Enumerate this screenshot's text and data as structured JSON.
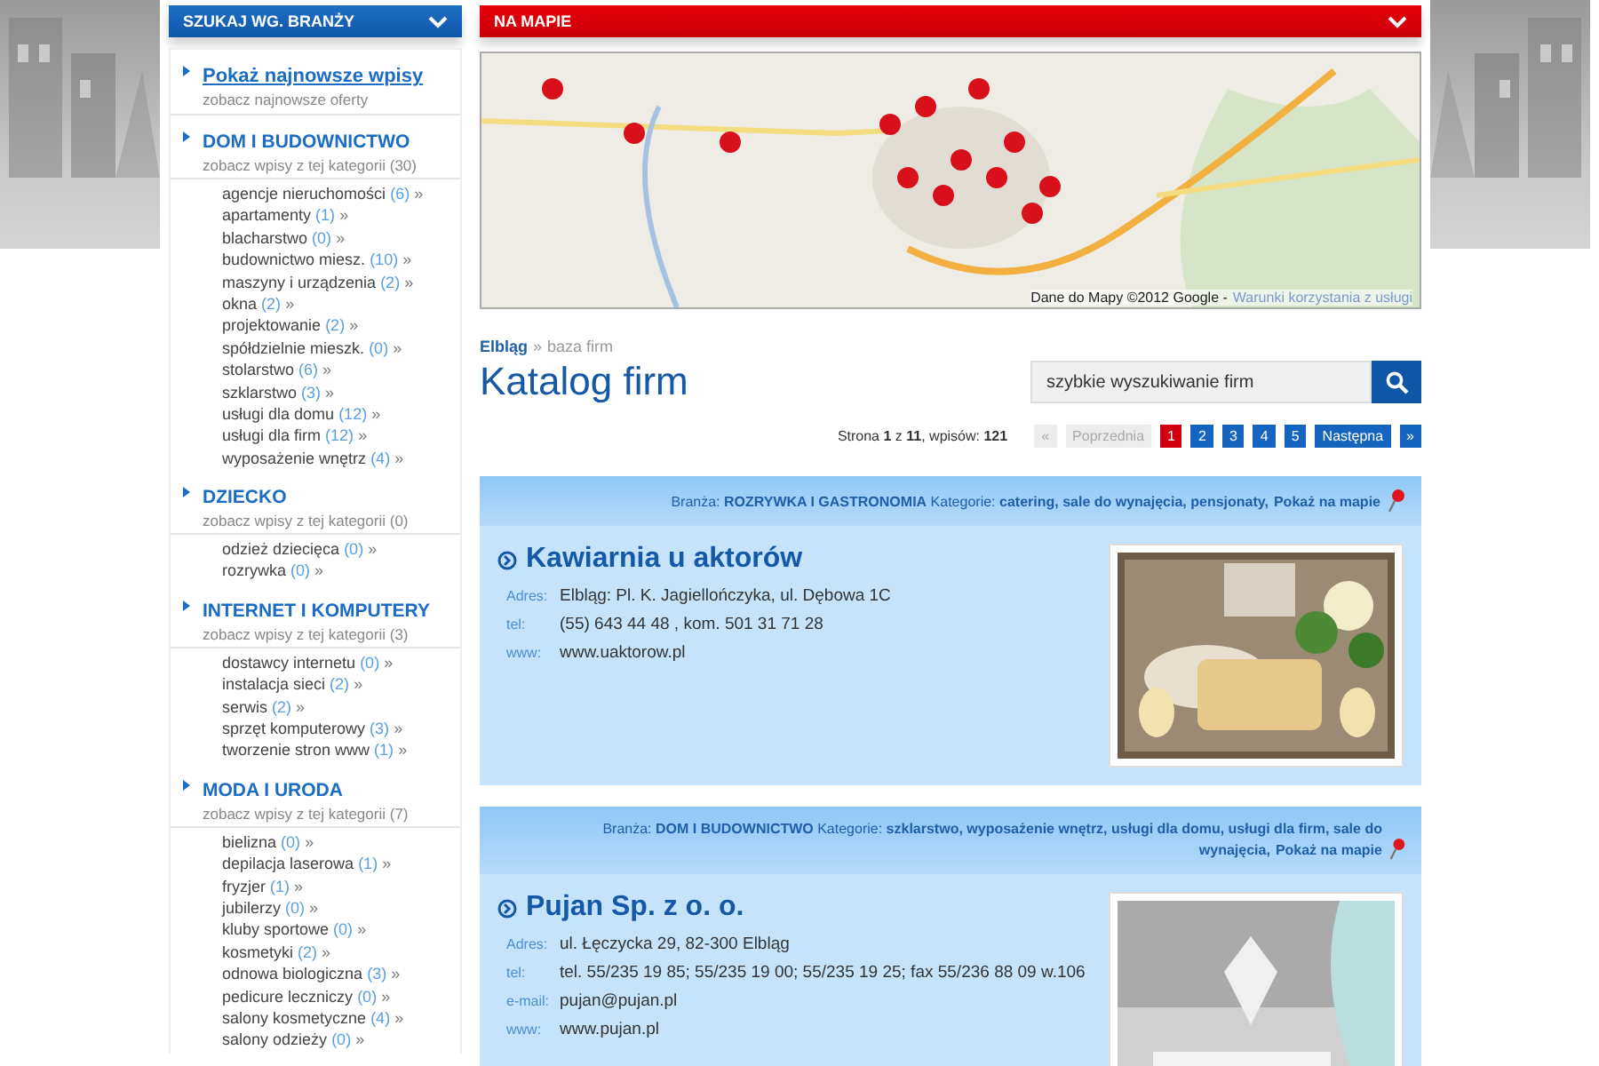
{
  "sidebar": {
    "title": "SZUKAJ WG. BRANŻY",
    "sections": [
      {
        "kind": "link",
        "title": "Pokaż najnowsze wpisy",
        "subtitle": "zobacz najnowsze oferty"
      },
      {
        "kind": "category",
        "title": "DOM I BUDOWNICTWO",
        "subtitle": "zobacz wpisy z tej kategorii",
        "count": "(30)",
        "items": [
          {
            "label": "agencje nieruchomości",
            "count": "(6)",
            "arrow": "»"
          },
          {
            "label": "apartamenty",
            "count": "(1)",
            "arrow": "»"
          },
          {
            "label": "blacharstwo",
            "count": "(0)",
            "arrow": "»"
          },
          {
            "label": "budownictwo miesz.",
            "count": "(10)",
            "arrow": "»"
          },
          {
            "label": "maszyny i urządzenia",
            "count": "(2)",
            "arrow": "»"
          },
          {
            "label": "okna",
            "count": "(2)",
            "arrow": "»"
          },
          {
            "label": "projektowanie",
            "count": "(2)",
            "arrow": "»"
          },
          {
            "label": "spółdzielnie mieszk.",
            "count": "(0)",
            "arrow": "»"
          },
          {
            "label": "stolarstwo",
            "count": "(6)",
            "arrow": "»"
          },
          {
            "label": "szklarstwo",
            "count": "(3)",
            "arrow": "»"
          },
          {
            "label": "usługi dla domu",
            "count": "(12)",
            "arrow": "»"
          },
          {
            "label": "usługi dla firm",
            "count": "(12)",
            "arrow": "»"
          },
          {
            "label": "wyposażenie wnętrz",
            "count": "(4)",
            "arrow": "»"
          }
        ]
      },
      {
        "kind": "category",
        "title": "DZIECKO",
        "subtitle": "zobacz wpisy z tej kategorii",
        "count": "(0)",
        "items": [
          {
            "label": "odzież dziecięca",
            "count": "(0)",
            "arrow": "»"
          },
          {
            "label": "rozrywka",
            "count": "(0)",
            "arrow": "»"
          }
        ]
      },
      {
        "kind": "category",
        "title": "INTERNET I KOMPUTERY",
        "subtitle": "zobacz wpisy z tej kategorii",
        "count": "(3)",
        "items": [
          {
            "label": "dostawcy internetu",
            "count": "(0)",
            "arrow": "»"
          },
          {
            "label": "instalacja sieci",
            "count": "(2)",
            "arrow": "»"
          },
          {
            "label": "serwis",
            "count": "(2)",
            "arrow": "»"
          },
          {
            "label": "sprzęt komputerowy",
            "count": "(3)",
            "arrow": "»"
          },
          {
            "label": "tworzenie stron www",
            "count": "(1)",
            "arrow": "»"
          }
        ]
      },
      {
        "kind": "category",
        "title": "MODA I URODA",
        "subtitle": "zobacz wpisy z tej kategorii",
        "count": "(7)",
        "items": [
          {
            "label": "bielizna",
            "count": "(0)",
            "arrow": "»"
          },
          {
            "label": "depilacja laserowa",
            "count": "(1)",
            "arrow": "»"
          },
          {
            "label": "fryzjer",
            "count": "(1)",
            "arrow": "»"
          },
          {
            "label": "jubilerzy",
            "count": "(0)",
            "arrow": "»"
          },
          {
            "label": "kluby sportowe",
            "count": "(0)",
            "arrow": "»"
          },
          {
            "label": "kosmetyki",
            "count": "(2)",
            "arrow": "»"
          },
          {
            "label": "odnowa biologiczna",
            "count": "(3)",
            "arrow": "»"
          },
          {
            "label": "pedicure leczniczy",
            "count": "(0)",
            "arrow": "»"
          },
          {
            "label": "salony kosmetyczne",
            "count": "(4)",
            "arrow": "»"
          },
          {
            "label": "salony odzieży",
            "count": "(0)",
            "arrow": "»"
          }
        ]
      }
    ]
  },
  "map": {
    "title": "NA MAPIE",
    "attribution": "Dane do Mapy ©2012 Google -",
    "terms": "Warunki korzystania z usługi"
  },
  "breadcrumb": {
    "home": "Elbląg",
    "separator": "»",
    "current": "baza firm"
  },
  "heading": "Katalog firm",
  "search": {
    "placeholder": "szybkie wyszukiwanie firm"
  },
  "pagination": {
    "summary": "Strona **1** z **11**, wpisów: **121**",
    "first": "«",
    "prev": "Poprzednia",
    "prev_disabled": true,
    "pages": [
      {
        "label": "1",
        "selected": true
      },
      {
        "label": "2",
        "selected": false
      },
      {
        "label": "3",
        "selected": false
      },
      {
        "label": "4",
        "selected": false
      },
      {
        "label": "5",
        "selected": false
      }
    ],
    "next": "Następna",
    "last": "»"
  },
  "listings": [
    {
      "tags": "Branża: **ROZRYWKA I GASTRONOMIA** Kategorie: **catering, sale do wynajęcia, pensjonaty,**",
      "map_link": "Pokaż na mapie",
      "name": "Kawiarnia u aktorów",
      "fields": [
        {
          "label": "Adres:",
          "value": "Elbląg: Pl. K. Jagiellończyka, ul. Dębowa 1C"
        },
        {
          "label": "tel:",
          "value": "(55) 643 44 48 , kom. 501 31 71 28"
        },
        {
          "label": "www:",
          "value": "www.uaktorow.pl"
        }
      ]
    },
    {
      "tags": "Branża: **DOM I BUDOWNICTWO** Kategorie: **szklarstwo, wyposażenie wnętrz, usługi dla domu, usługi dla firm, sale do wynajęcia,**",
      "map_link": "Pokaż na mapie",
      "name": "Pujan Sp. z o. o.",
      "fields": [
        {
          "label": "Adres:",
          "value": "ul. Łęczycka 29, 82-300 Elbląg"
        },
        {
          "label": "tel:",
          "value": "tel. 55/235 19 85; 55/235 19 00; 55/235 19 25; fax 55/236 88 09 w.106"
        },
        {
          "label": "e-mail:",
          "value": "pujan@pujan.pl"
        },
        {
          "label": "www:",
          "value": "www.pujan.pl"
        }
      ]
    }
  ]
}
